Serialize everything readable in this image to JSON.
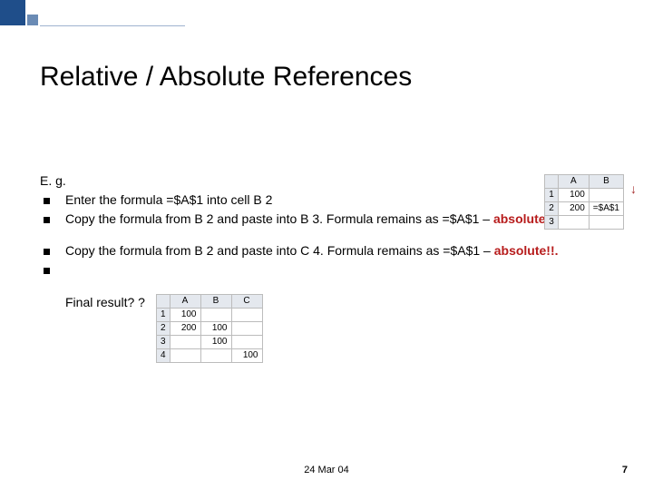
{
  "title": "Relative / Absolute References",
  "eg_label": "E. g.",
  "bullets_group1": [
    "Enter the formula =$A$1 into cell B 2",
    "Copy the formula from B 2 and paste into B 3. Formula remains as =$A$1 – "
  ],
  "absolute_label": "absolute!!.",
  "bullets_group2": [
    "Copy the formula from B 2 and paste into C 4. Formula remains as =$A$1 – "
  ],
  "final_label": "Final result? ?",
  "top_grid": {
    "cols": [
      "A",
      "B"
    ],
    "rows": [
      {
        "n": "1",
        "cells": [
          "100",
          ""
        ]
      },
      {
        "n": "2",
        "cells": [
          "200",
          "=$A$1"
        ]
      },
      {
        "n": "3",
        "cells": [
          "",
          ""
        ]
      }
    ]
  },
  "result_grid": {
    "cols": [
      "A",
      "B",
      "C"
    ],
    "rows": [
      {
        "n": "1",
        "cells": [
          "100",
          "",
          ""
        ]
      },
      {
        "n": "2",
        "cells": [
          "200",
          "100",
          ""
        ]
      },
      {
        "n": "3",
        "cells": [
          "",
          "100",
          ""
        ]
      },
      {
        "n": "4",
        "cells": [
          "",
          "",
          "100"
        ]
      }
    ]
  },
  "footer": {
    "date": "24 Mar 04",
    "page": "7"
  }
}
